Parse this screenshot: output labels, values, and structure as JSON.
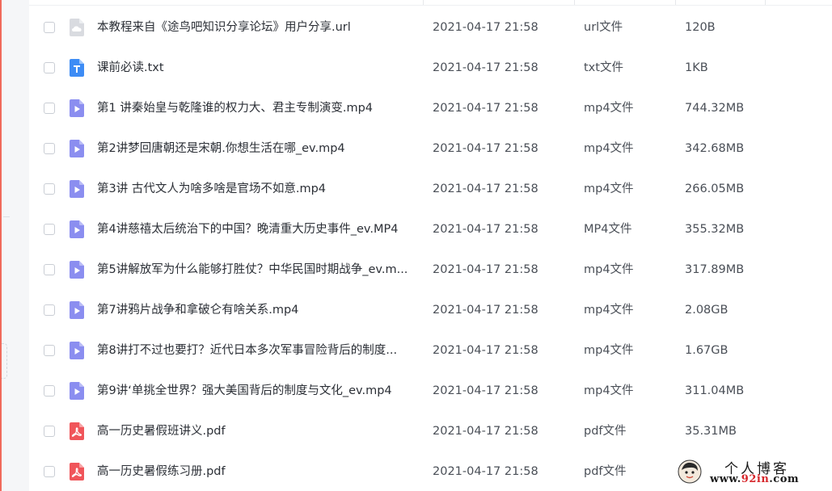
{
  "files": [
    {
      "name": "本教程来自《途鸟吧知识分享论坛》用户分享.url",
      "date": "2021-04-17 21:58",
      "type": "url文件",
      "size": "120B",
      "icon": "cloud-file-icon"
    },
    {
      "name": "课前必读.txt",
      "date": "2021-04-17 21:58",
      "type": "txt文件",
      "size": "1KB",
      "icon": "text-file-icon"
    },
    {
      "name": "第1 讲秦始皇与乾隆谁的权力大、君主专制演变.mp4",
      "date": "2021-04-17 21:58",
      "type": "mp4文件",
      "size": "744.32MB",
      "icon": "video-file-icon"
    },
    {
      "name": "第2讲梦回唐朝还是宋朝.你想生活在哪_ev.mp4",
      "date": "2021-04-17 21:58",
      "type": "mp4文件",
      "size": "342.68MB",
      "icon": "video-file-icon"
    },
    {
      "name": "第3讲 古代文人为啥多啥是官场不如意.mp4",
      "date": "2021-04-17 21:58",
      "type": "mp4文件",
      "size": "266.05MB",
      "icon": "video-file-icon"
    },
    {
      "name": "第4讲慈禧太后统治下的中国？晚清重大历史事件_ev.MP4",
      "date": "2021-04-17 21:58",
      "type": "MP4文件",
      "size": "355.32MB",
      "icon": "video-file-icon"
    },
    {
      "name": "第5讲解放军为什么能够打胜仗？中华民国时期战争_ev.m...",
      "date": "2021-04-17 21:58",
      "type": "mp4文件",
      "size": "317.89MB",
      "icon": "video-file-icon"
    },
    {
      "name": "第7讲鸦片战争和拿破仑有啥关系.mp4",
      "date": "2021-04-17 21:58",
      "type": "mp4文件",
      "size": "2.08GB",
      "icon": "video-file-icon"
    },
    {
      "name": "第8讲打不过也要打？近代日本多次军事冒险背后的制度...",
      "date": "2021-04-17 21:58",
      "type": "mp4文件",
      "size": "1.67GB",
      "icon": "video-file-icon"
    },
    {
      "name": "第9讲‘单挑全世界？强大美国背后的制度与文化_ev.mp4",
      "date": "2021-04-17 21:58",
      "type": "mp4文件",
      "size": "311.04MB",
      "icon": "video-file-icon"
    },
    {
      "name": "高一历史暑假班讲义.pdf",
      "date": "2021-04-17 21:58",
      "type": "pdf文件",
      "size": "35.31MB",
      "icon": "pdf-file-icon"
    },
    {
      "name": "高一历史暑假练习册.pdf",
      "date": "2021-04-17 21:58",
      "type": "pdf文件",
      "size": "",
      "icon": "pdf-file-icon"
    }
  ],
  "watermark": {
    "title": "个人博客",
    "url_prefix": "www.",
    "url_accent": "92in",
    "url_suffix": ".com"
  },
  "colors": {
    "video_icon": "#8b8ef0",
    "text_icon": "#3d8cf5",
    "pdf_icon": "#f0555a",
    "cloud_icon": "#d9dbe0",
    "accent_strip": "#f06a5b"
  }
}
